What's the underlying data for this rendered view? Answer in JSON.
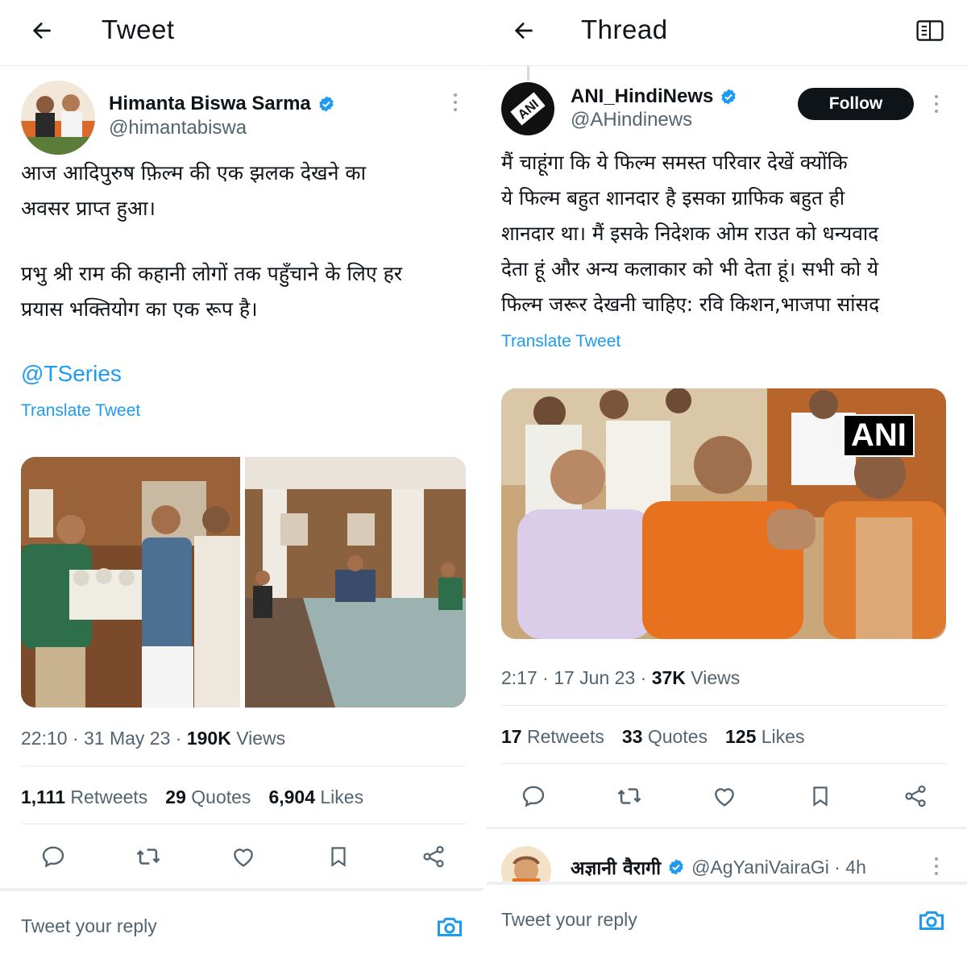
{
  "left": {
    "header": {
      "title": "Tweet"
    },
    "author": {
      "name": "Himanta Biswa Sarma",
      "handle": "@himantabiswa"
    },
    "text_para1": "आज आदिपुरुष फ़िल्म की एक झलक देखने का\nअवसर प्राप्त हुआ।",
    "text_para2": "प्रभु श्री राम की कहानी लोगों तक पहुँचाने के लिए हर\nप्रयास भक्तियोग का एक रूप है।",
    "mention": "@TSeries",
    "translate": "Translate Tweet",
    "meta": {
      "time": "22:10 · 31 May 23 · ",
      "views_count": "190K",
      "views_label": " Views"
    },
    "stats": {
      "retweets_count": "1,111",
      "retweets_label": "Retweets",
      "quotes_count": "29",
      "quotes_label": "Quotes",
      "likes_count": "6,904",
      "likes_label": "Likes"
    },
    "reply_placeholder": "Tweet your reply"
  },
  "right": {
    "header": {
      "title": "Thread"
    },
    "author": {
      "name": "ANI_HindiNews",
      "handle": "@AHindinews"
    },
    "follow_label": "Follow",
    "text": "मैं चाहूंगा कि ये फिल्म समस्त परिवार देखें क्योंकि\nये फिल्म बहुत शानदार है इसका ग्राफिक बहुत ही\nशानदार था। मैं इसके निदेशक ओम राउत को धन्यवाद\nदेता हूं और अन्य कलाकार को भी देता हूं। सभी को ये\nफिल्म जरूर देखनी चाहिए: रवि किशन,भाजपा सांसद",
    "translate": "Translate Tweet",
    "media_badge": "ANI",
    "meta": {
      "time": "2:17 · 17 Jun 23 · ",
      "views_count": "37K",
      "views_label": " Views"
    },
    "stats": {
      "retweets_count": "17",
      "retweets_label": "Retweets",
      "quotes_count": "33",
      "quotes_label": "Quotes",
      "likes_count": "125",
      "likes_label": "Likes"
    },
    "reply_preview": {
      "name": "अज्ञानी वैरागी",
      "handle": "@AgYaniVairaGi · 4h"
    },
    "reply_placeholder": "Tweet your reply"
  },
  "colors": {
    "accent": "#1d9bf0",
    "text": "#0f1419",
    "muted": "#536471",
    "saffron": "#e8711f"
  }
}
